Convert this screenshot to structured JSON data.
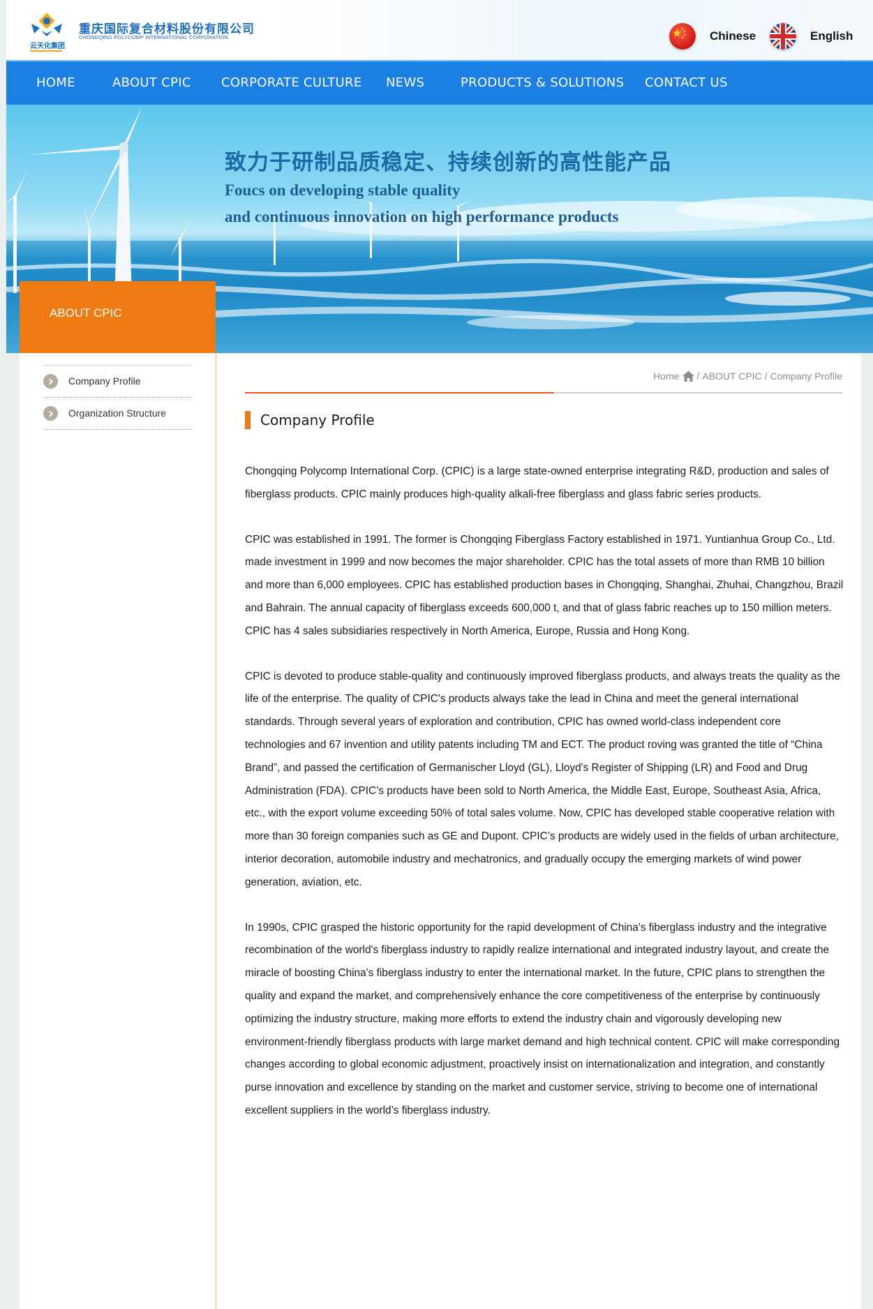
{
  "header": {
    "company_cn": "重庆国际复合材料股份有限公司",
    "company_en": "CHONGQING POLYCOMP INTERNATIONAL CORPORATION",
    "group_cn": "云天化集团",
    "languages": [
      {
        "label": "Chinese",
        "flag": "china-flag-icon"
      },
      {
        "label": "English",
        "flag": "uk-flag-icon"
      }
    ]
  },
  "nav": {
    "items": [
      {
        "label": "HOME"
      },
      {
        "label": "ABOUT CPIC"
      },
      {
        "label": "CORPORATE CULTURE"
      },
      {
        "label": "NEWS"
      },
      {
        "label": "PRODUCTS & SOLUTIONS"
      },
      {
        "label": "CONTACT US"
      }
    ]
  },
  "banner": {
    "slogan_cn": "致力于研制品质稳定、持续创新的高性能产品",
    "slogan_en_line1": "Foucs on developing stable quality",
    "slogan_en_line2": "and  continuous innovation on high performance products"
  },
  "sidebar": {
    "title": "ABOUT CPIC",
    "items": [
      {
        "label": "Company Profile"
      },
      {
        "label": "Organization Structure"
      }
    ]
  },
  "breadcrumb": {
    "home": "Home",
    "section": "ABOUT CPIC",
    "current": "Company Profile",
    "separator": "/"
  },
  "main": {
    "title": "Company Profile",
    "paragraphs": [
      "Chongqing Polycomp International Corp. (CPIC) is a large state-owned enterprise integrating R&D, production and sales of fiberglass products.  CPIC mainly produces high-quality alkali-free fiberglass and glass fabric series products.",
      "CPIC was established in 1991. The former is Chongqing Fiberglass Factory established in 1971. Yuntianhua Group Co., Ltd. made investment in 1999 and now becomes the major shareholder. CPIC has the total assets of more than RMB 10 billion and more than 6,000 employees. CPIC has established production bases in Chongqing, Shanghai, Zhuhai, Changzhou, Brazil and Bahrain. The annual capacity of fiberglass exceeds 600,000 t, and that of glass fabric reaches up to 150 million meters. CPIC has 4 sales subsidiaries respectively in North America, Europe, Russia and Hong Kong.",
      "CPIC is devoted to produce stable-quality and continuously improved fiberglass products, and always treats the quality as the life of the enterprise. The quality of CPIC's products always take the lead in China and meet the general international standards. Through several years of exploration and contribution, CPIC has owned world-class independent core technologies and 67 invention and utility patents including TM and ECT. The product roving was granted the title of “China Brand”, and passed the certification of Germanischer Lloyd (GL), Lloyd's Register of Shipping (LR) and Food and Drug Administration (FDA). CPIC’s products have been sold to North America, the Middle East, Europe, Southeast Asia, Africa, etc., with the export volume exceeding 50% of total sales volume. Now, CPIC has developed stable cooperative relation with more than 30 foreign companies such as GE and Dupont. CPIC’s products are widely used in the fields of urban architecture, interior decoration, automobile industry and mechatronics, and gradually occupy the emerging markets of wind power generation, aviation, etc.",
      "In 1990s, CPIC grasped the historic opportunity for the rapid development of China's fiberglass industry and the integrative recombination of the world's fiberglass industry to rapidly realize international and integrated industry layout, and create the miracle of boosting China's fiberglass industry to enter the international market. In the future, CPIC plans to strengthen the quality and expand the market, and comprehensively enhance the core competitiveness of the enterprise by continuously optimizing the industry structure, making more efforts to extend the industry chain and vigorously developing new environment-friendly fiberglass products with large market demand and high technical content. CPIC will make corresponding changes according to global economic adjustment, proactively insist on internationalization and integration, and constantly purse innovation and excellence by standing on the market and customer service, striving to become one of international excellent suppliers in the world’s fiberglass industry."
    ]
  },
  "colors": {
    "nav_blue": "#1a80e4",
    "accent_orange": "#f07a12",
    "divider_red": "#e65a15",
    "brand_blue": "#1f6fbd"
  }
}
